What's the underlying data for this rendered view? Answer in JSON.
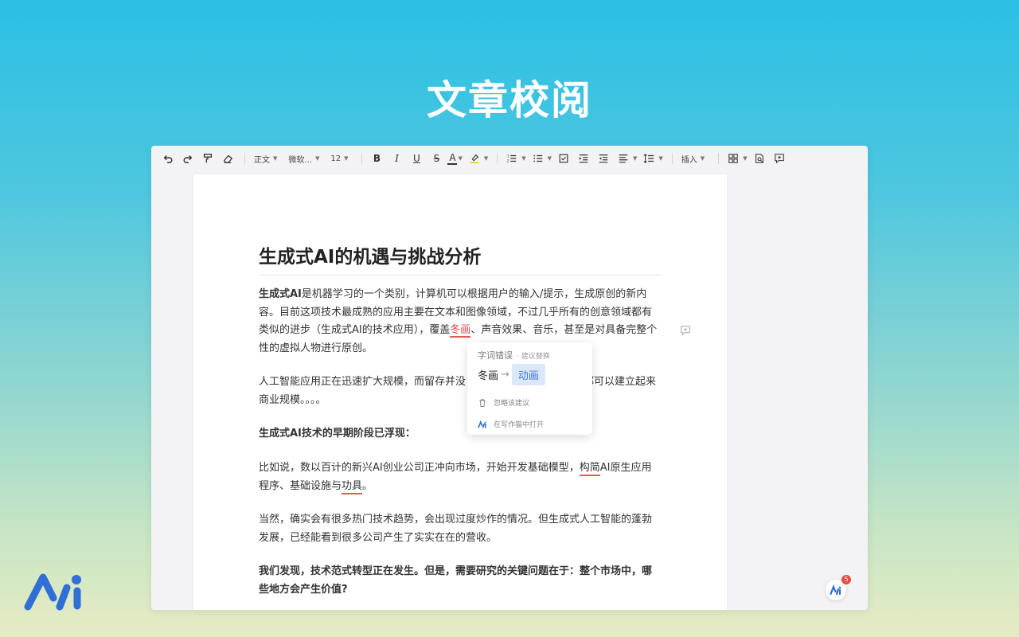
{
  "hero": {
    "title": "文章校阅"
  },
  "toolbar": {
    "style": "正文",
    "font": "微软...",
    "size": "12",
    "insert": "插入"
  },
  "doc": {
    "title": "生成式AI的机遇与挑战分析",
    "p1": {
      "bold": "生成式AI",
      "text_a": "是机器学习的一个类别，计算机可以根据用户的输入/提示，生成原创的新内容。目前这项技术最成熟的应用主要在文本和图像领域，不过几乎所有的创意领域都有类似的进步（生成式AI的技术应用），覆盖",
      "error": "冬画",
      "text_b": "、声音效果、音乐，甚至是对具备完整个性的虚拟人物进行原创。"
    },
    "p2": {
      "text_a": "人工智能应用正在迅速扩大规模，而留存并没",
      "text_b": "都可以建立起来商业规模。。。。"
    },
    "p3": {
      "bold": "生成式AI技术的早期阶段已浮现："
    },
    "p4": {
      "text_a": "比如说，数以百计的新兴AI创业公司正冲向市场，开始开发基础模型，",
      "error1": "构简",
      "text_b": "AI原生应用程序、基础设施与",
      "error2": "功具",
      "text_c": "。"
    },
    "p5": {
      "text": "当然，确实会有很多热门技术趋势，会出现过度炒作的情况。但生成式人工智能的蓬勃发展，已经能看到很多公司产生了实实在在的营收。"
    },
    "p6": {
      "bold": "我们发现，技术范式转型正在发生。但是，需要研究的关键问题在于：整个市场中，哪些地方会产生价值?"
    }
  },
  "popover": {
    "category": "字词错误",
    "hint": "· 建议替换",
    "original": "冬画",
    "suggestion": "动画",
    "ignore": "忽略该建议",
    "open": "在写作猫中打开"
  },
  "float_button": {
    "badge": "5"
  },
  "colors": {
    "accent": "#3b78e7",
    "error": "#e05a5a",
    "logo": "#2f6fd6"
  }
}
